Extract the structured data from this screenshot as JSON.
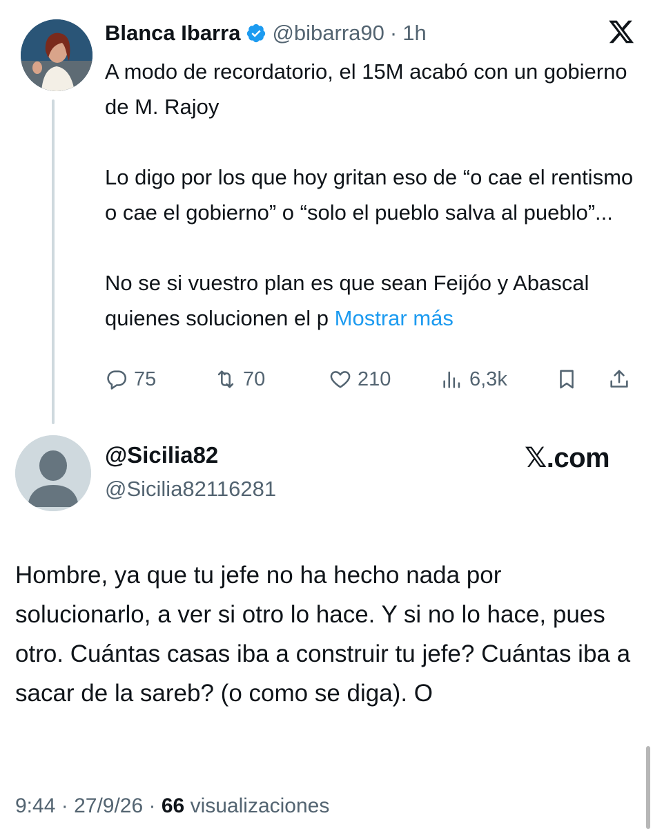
{
  "tweet": {
    "author_name": "Blanca Ibarra",
    "handle": "@bibarra90",
    "separator": "·",
    "time_ago": "1h",
    "paragraphs": [
      "A modo de recordatorio, el 15M acabó con un gobierno de M. Rajoy",
      "Lo digo por los que hoy gritan eso de “o cae el rentismo o cae el gobierno” o “solo el pueblo salva al pueblo”...",
      "No se si vuestro plan es que sean Feijóo y Abascal quienes solucionen el p"
    ],
    "show_more": "Mostrar más",
    "stats": {
      "replies": "75",
      "retweets": "70",
      "likes": "210",
      "views": "6,3k"
    }
  },
  "reply": {
    "display_name": "@Sicilia82",
    "handle": "@Sicilia82116281",
    "brand": "𝕏.com",
    "text": "Hombre, ya que tu jefe no ha hecho nada por solucionarlo, a ver si otro lo hace. Y si no lo hace, pues otro. Cuántas casas iba a construir tu jefe? Cuántas iba a sacar de la sareb? (o como se diga). O",
    "time": "9:44",
    "separator": "·",
    "date": "27/9/26",
    "separator2": "·",
    "views_count": "66",
    "views_label": "visualizaciones"
  },
  "colors": {
    "accent": "#1d9bf0",
    "muted": "#536471",
    "text": "#0f1419"
  }
}
